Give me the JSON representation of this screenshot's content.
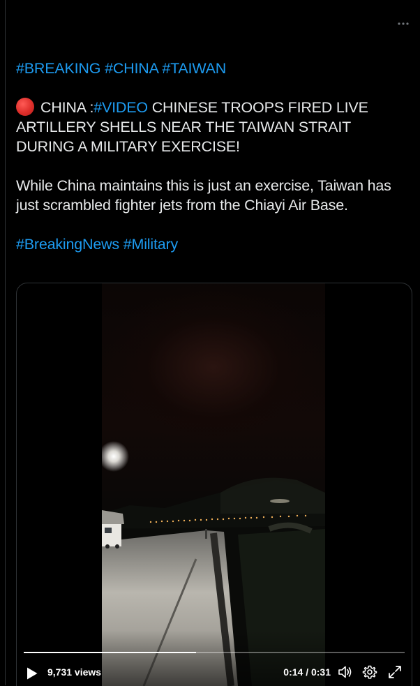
{
  "tweet": {
    "line1_tags": [
      "#BREAKING",
      "#CHINA",
      "#TAIWAN"
    ],
    "para2": {
      "prefix": "CHINA :",
      "tag": "#VIDEO",
      "text": " CHINESE TROOPS FIRED LIVE ARTILLERY SHELLS NEAR THE TAIWAN STRAIT DURING A MILITARY EXERCISE!"
    },
    "para3": "While China maintains this is just an exercise, Taiwan has just scrambled fighter jets from the Chiayi Air Base.",
    "footer_tags": [
      "#BreakingNews",
      "#Military"
    ],
    "icons": {
      "more": "more-icon",
      "status": "red-circle-icon"
    }
  },
  "video": {
    "views": "9,731 views",
    "time": "0:14 / 0:31",
    "progress": 0.4516,
    "icons": {
      "play": "play-icon",
      "volume": "volume-icon",
      "settings": "gear-icon",
      "fullscreen": "fullscreen-icon"
    }
  },
  "colors": {
    "background": "#000000",
    "text": "#e7e9ea",
    "link": "#1d9bf0",
    "border": "#2f3336"
  }
}
